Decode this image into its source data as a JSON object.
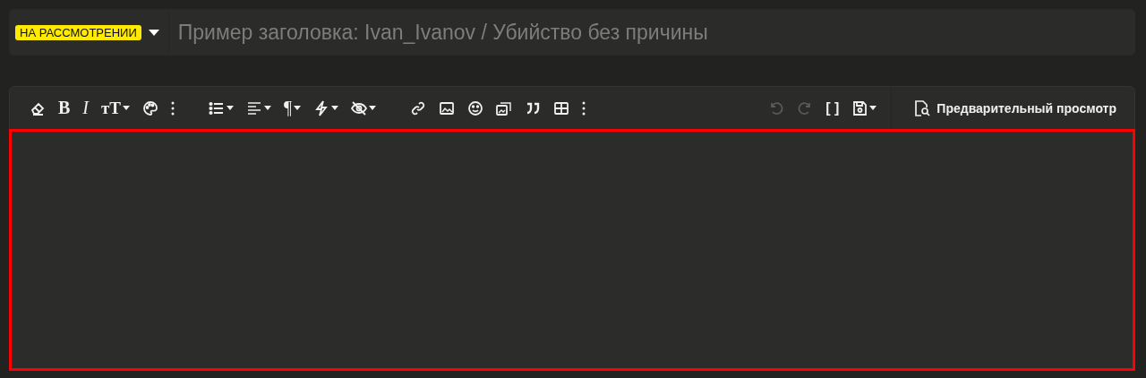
{
  "title_bar": {
    "prefix_badge": "НА РАССМОТРЕНИИ",
    "title_field": {
      "placeholder": "Пример заголовка: Ivan_Ivanov / Убийство без причины"
    }
  },
  "toolbar": {
    "groups": [
      [
        {
          "kind": "eraser",
          "dropdown": false,
          "disabled": false
        },
        {
          "kind": "bold",
          "glyph": "B",
          "dropdown": false,
          "disabled": false
        },
        {
          "kind": "italic",
          "glyph": "I",
          "dropdown": false,
          "disabled": false
        },
        {
          "kind": "size",
          "glyph": "тT",
          "dropdown": true,
          "disabled": false
        },
        {
          "kind": "palette",
          "dropdown": false,
          "disabled": false
        },
        {
          "kind": "more",
          "dropdown": false,
          "disabled": false
        }
      ],
      [
        {
          "kind": "list",
          "dropdown": true,
          "disabled": false
        },
        {
          "kind": "align",
          "dropdown": true,
          "disabled": false
        },
        {
          "kind": "paragraph",
          "glyph": "¶",
          "dropdown": true,
          "disabled": false
        },
        {
          "kind": "bolt",
          "dropdown": true,
          "disabled": false
        },
        {
          "kind": "hidden",
          "dropdown": true,
          "disabled": false
        }
      ],
      [
        {
          "kind": "link",
          "dropdown": false,
          "disabled": false
        },
        {
          "kind": "image",
          "dropdown": false,
          "disabled": false
        },
        {
          "kind": "smile",
          "dropdown": false,
          "disabled": false
        },
        {
          "kind": "media",
          "dropdown": false,
          "disabled": false
        },
        {
          "kind": "quote",
          "dropdown": false,
          "disabled": false
        },
        {
          "kind": "table",
          "dropdown": false,
          "disabled": false
        },
        {
          "kind": "more",
          "dropdown": false,
          "disabled": false
        }
      ],
      [
        {
          "kind": "undo",
          "dropdown": false,
          "disabled": true
        },
        {
          "kind": "redo",
          "dropdown": false,
          "disabled": true
        },
        {
          "kind": "fullscreen",
          "glyph": "[ ]",
          "dropdown": false,
          "disabled": false
        },
        {
          "kind": "save",
          "dropdown": true,
          "disabled": false
        }
      ]
    ],
    "preview_button": "Предварительный просмотр"
  },
  "editor": {
    "highlighted": true
  }
}
